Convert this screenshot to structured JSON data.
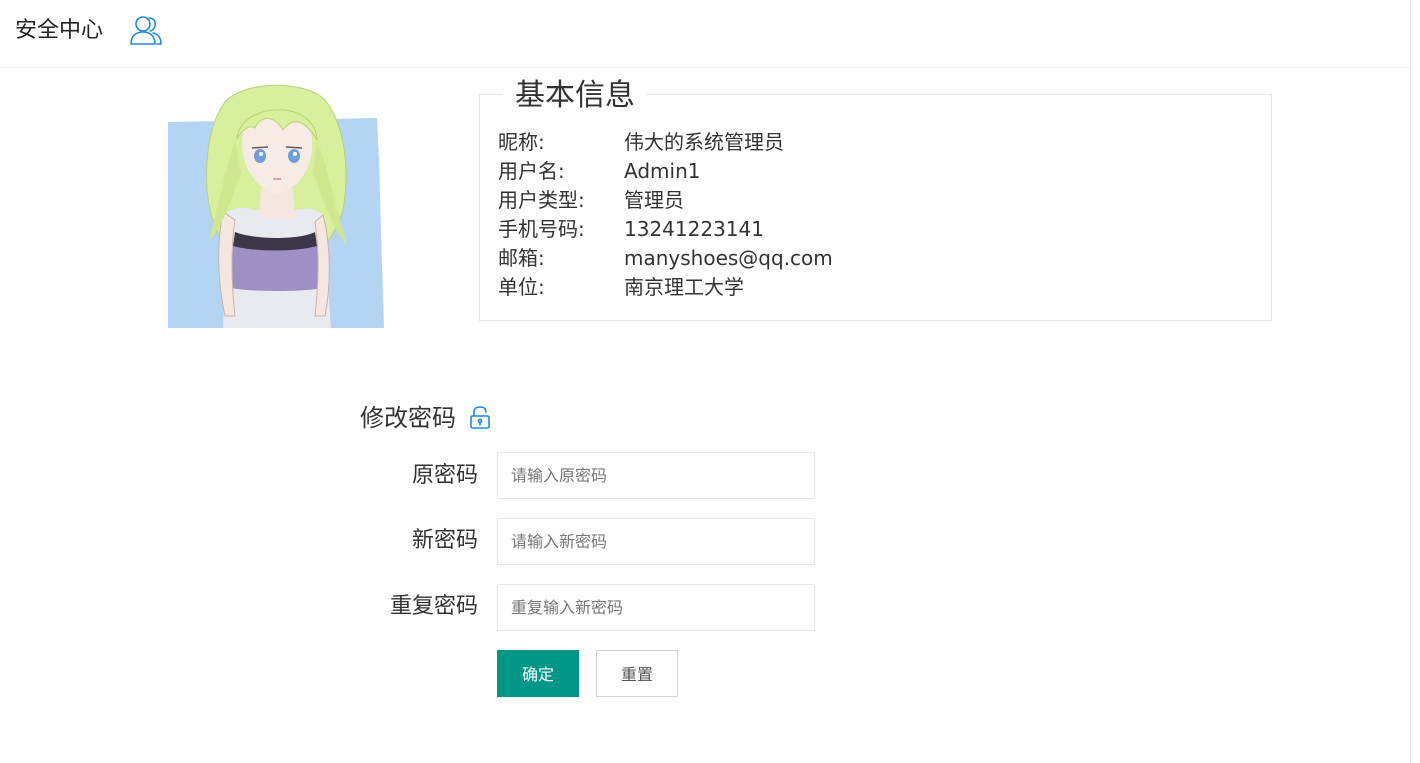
{
  "header": {
    "title": "安全中心",
    "icon": "user-group-icon",
    "accent_color": "#1e88e5"
  },
  "basic_info": {
    "legend": "基本信息",
    "rows": [
      {
        "label": "昵称:",
        "value": "伟大的系统管理员"
      },
      {
        "label": "用户名:",
        "value": "Admin1"
      },
      {
        "label": "用户类型:",
        "value": "管理员"
      },
      {
        "label": "手机号码:",
        "value": "13241223141"
      },
      {
        "label": "邮箱:",
        "value": "manyshoes@qq.com"
      },
      {
        "label": "单位:",
        "value": "南京理工大学"
      }
    ]
  },
  "password": {
    "title": "修改密码",
    "icon": "unlock-icon",
    "fields": [
      {
        "label": "原密码",
        "placeholder": "请输入原密码",
        "value": ""
      },
      {
        "label": "新密码",
        "placeholder": "请输入新密码",
        "value": ""
      },
      {
        "label": "重复密码",
        "placeholder": "重复输入新密码",
        "value": ""
      }
    ],
    "submit_label": "确定",
    "reset_label": "重置",
    "primary_color": "#009688"
  }
}
